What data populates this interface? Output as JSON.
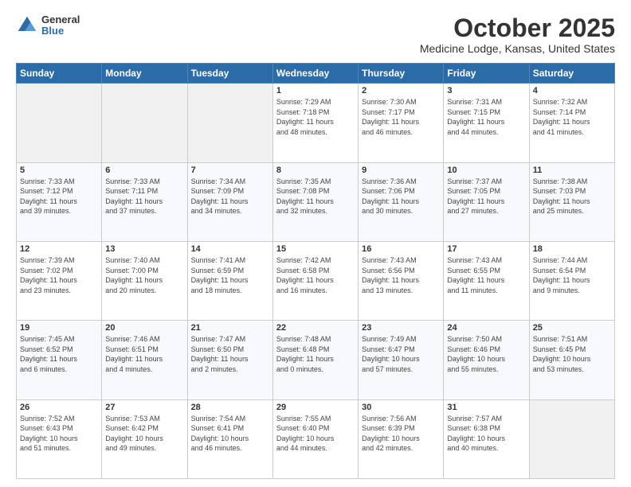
{
  "header": {
    "logo_general": "General",
    "logo_blue": "Blue",
    "month_title": "October 2025",
    "location": "Medicine Lodge, Kansas, United States"
  },
  "days_of_week": [
    "Sunday",
    "Monday",
    "Tuesday",
    "Wednesday",
    "Thursday",
    "Friday",
    "Saturday"
  ],
  "weeks": [
    [
      {
        "day": "",
        "info": ""
      },
      {
        "day": "",
        "info": ""
      },
      {
        "day": "",
        "info": ""
      },
      {
        "day": "1",
        "info": "Sunrise: 7:29 AM\nSunset: 7:18 PM\nDaylight: 11 hours\nand 48 minutes."
      },
      {
        "day": "2",
        "info": "Sunrise: 7:30 AM\nSunset: 7:17 PM\nDaylight: 11 hours\nand 46 minutes."
      },
      {
        "day": "3",
        "info": "Sunrise: 7:31 AM\nSunset: 7:15 PM\nDaylight: 11 hours\nand 44 minutes."
      },
      {
        "day": "4",
        "info": "Sunrise: 7:32 AM\nSunset: 7:14 PM\nDaylight: 11 hours\nand 41 minutes."
      }
    ],
    [
      {
        "day": "5",
        "info": "Sunrise: 7:33 AM\nSunset: 7:12 PM\nDaylight: 11 hours\nand 39 minutes."
      },
      {
        "day": "6",
        "info": "Sunrise: 7:33 AM\nSunset: 7:11 PM\nDaylight: 11 hours\nand 37 minutes."
      },
      {
        "day": "7",
        "info": "Sunrise: 7:34 AM\nSunset: 7:09 PM\nDaylight: 11 hours\nand 34 minutes."
      },
      {
        "day": "8",
        "info": "Sunrise: 7:35 AM\nSunset: 7:08 PM\nDaylight: 11 hours\nand 32 minutes."
      },
      {
        "day": "9",
        "info": "Sunrise: 7:36 AM\nSunset: 7:06 PM\nDaylight: 11 hours\nand 30 minutes."
      },
      {
        "day": "10",
        "info": "Sunrise: 7:37 AM\nSunset: 7:05 PM\nDaylight: 11 hours\nand 27 minutes."
      },
      {
        "day": "11",
        "info": "Sunrise: 7:38 AM\nSunset: 7:03 PM\nDaylight: 11 hours\nand 25 minutes."
      }
    ],
    [
      {
        "day": "12",
        "info": "Sunrise: 7:39 AM\nSunset: 7:02 PM\nDaylight: 11 hours\nand 23 minutes."
      },
      {
        "day": "13",
        "info": "Sunrise: 7:40 AM\nSunset: 7:00 PM\nDaylight: 11 hours\nand 20 minutes."
      },
      {
        "day": "14",
        "info": "Sunrise: 7:41 AM\nSunset: 6:59 PM\nDaylight: 11 hours\nand 18 minutes."
      },
      {
        "day": "15",
        "info": "Sunrise: 7:42 AM\nSunset: 6:58 PM\nDaylight: 11 hours\nand 16 minutes."
      },
      {
        "day": "16",
        "info": "Sunrise: 7:43 AM\nSunset: 6:56 PM\nDaylight: 11 hours\nand 13 minutes."
      },
      {
        "day": "17",
        "info": "Sunrise: 7:43 AM\nSunset: 6:55 PM\nDaylight: 11 hours\nand 11 minutes."
      },
      {
        "day": "18",
        "info": "Sunrise: 7:44 AM\nSunset: 6:54 PM\nDaylight: 11 hours\nand 9 minutes."
      }
    ],
    [
      {
        "day": "19",
        "info": "Sunrise: 7:45 AM\nSunset: 6:52 PM\nDaylight: 11 hours\nand 6 minutes."
      },
      {
        "day": "20",
        "info": "Sunrise: 7:46 AM\nSunset: 6:51 PM\nDaylight: 11 hours\nand 4 minutes."
      },
      {
        "day": "21",
        "info": "Sunrise: 7:47 AM\nSunset: 6:50 PM\nDaylight: 11 hours\nand 2 minutes."
      },
      {
        "day": "22",
        "info": "Sunrise: 7:48 AM\nSunset: 6:48 PM\nDaylight: 11 hours\nand 0 minutes."
      },
      {
        "day": "23",
        "info": "Sunrise: 7:49 AM\nSunset: 6:47 PM\nDaylight: 10 hours\nand 57 minutes."
      },
      {
        "day": "24",
        "info": "Sunrise: 7:50 AM\nSunset: 6:46 PM\nDaylight: 10 hours\nand 55 minutes."
      },
      {
        "day": "25",
        "info": "Sunrise: 7:51 AM\nSunset: 6:45 PM\nDaylight: 10 hours\nand 53 minutes."
      }
    ],
    [
      {
        "day": "26",
        "info": "Sunrise: 7:52 AM\nSunset: 6:43 PM\nDaylight: 10 hours\nand 51 minutes."
      },
      {
        "day": "27",
        "info": "Sunrise: 7:53 AM\nSunset: 6:42 PM\nDaylight: 10 hours\nand 49 minutes."
      },
      {
        "day": "28",
        "info": "Sunrise: 7:54 AM\nSunset: 6:41 PM\nDaylight: 10 hours\nand 46 minutes."
      },
      {
        "day": "29",
        "info": "Sunrise: 7:55 AM\nSunset: 6:40 PM\nDaylight: 10 hours\nand 44 minutes."
      },
      {
        "day": "30",
        "info": "Sunrise: 7:56 AM\nSunset: 6:39 PM\nDaylight: 10 hours\nand 42 minutes."
      },
      {
        "day": "31",
        "info": "Sunrise: 7:57 AM\nSunset: 6:38 PM\nDaylight: 10 hours\nand 40 minutes."
      },
      {
        "day": "",
        "info": ""
      }
    ]
  ]
}
